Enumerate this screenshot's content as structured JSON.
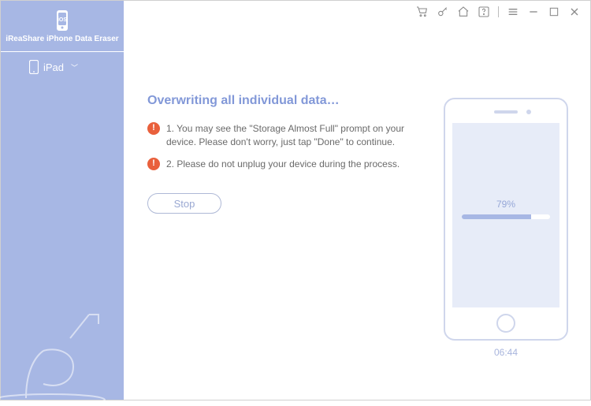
{
  "app": {
    "title": "iReaShare iPhone Data Eraser"
  },
  "sidebar": {
    "device_label": "iPad"
  },
  "titlebar": {
    "icons": [
      "cart-icon",
      "key-icon",
      "home-icon",
      "help-icon",
      "menu-icon",
      "minimize-icon",
      "maximize-icon",
      "close-icon"
    ]
  },
  "progress": {
    "heading": "Overwriting all individual data…",
    "note1": "1. You may see the \"Storage Almost Full\" prompt on your device. Please don't worry, just tap \"Done\" to continue.",
    "note2": "2. Please do not unplug your device during the process.",
    "stop_label": "Stop",
    "percent_label": "79%",
    "percent_value": 79,
    "elapsed": "06:44"
  },
  "colors": {
    "sidebar_bg": "#a7b7e4",
    "accent_text": "#8298d8",
    "alert_bg": "#e9603c",
    "device_outline": "#cfd6ec"
  }
}
